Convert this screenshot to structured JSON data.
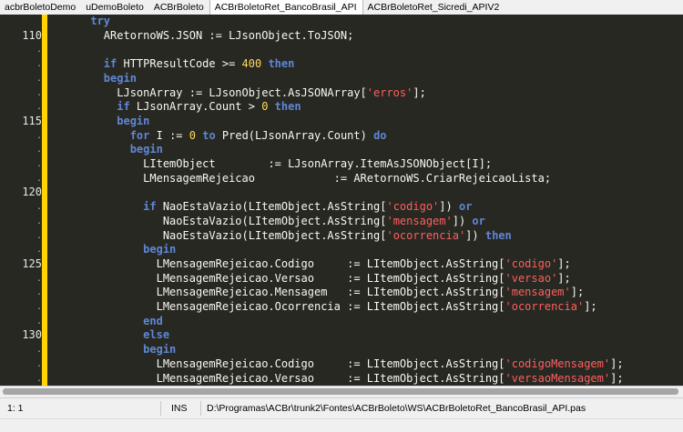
{
  "tabs": [
    {
      "label": "acbrBoletoDemo",
      "active": false
    },
    {
      "label": "uDemoBoleto",
      "active": false
    },
    {
      "label": "ACBrBoleto",
      "active": false
    },
    {
      "label": "ACBrBoletoRet_BancoBrasil_API",
      "active": true
    },
    {
      "label": "ACBrBoletoRet_Sicredi_APIV2",
      "active": false
    }
  ],
  "gutter": [
    "",
    "110",
    ".",
    ".",
    ".",
    ".",
    ".",
    "115",
    ".",
    ".",
    ".",
    ".",
    "120",
    ".",
    ".",
    ".",
    ".",
    "125",
    ".",
    ".",
    ".",
    ".",
    "130",
    ".",
    ".",
    ".",
    "."
  ],
  "code_lines": [
    [
      [
        "kw",
        "      try"
      ]
    ],
    [
      [
        "t",
        "        ARetornoWS.JSON := LJsonObject.ToJSON;"
      ]
    ],
    [
      [
        "t",
        ""
      ]
    ],
    [
      [
        "t",
        "        "
      ],
      [
        "kw",
        "if"
      ],
      [
        "t",
        " HTTPResultCode >= "
      ],
      [
        "num",
        "400"
      ],
      [
        "t",
        " "
      ],
      [
        "kw",
        "then"
      ]
    ],
    [
      [
        "t",
        "        "
      ],
      [
        "kw",
        "begin"
      ]
    ],
    [
      [
        "t",
        "          LJsonArray := LJsonObject.AsJSONArray["
      ],
      [
        "str",
        "'erros'"
      ],
      [
        "t",
        "];"
      ]
    ],
    [
      [
        "t",
        "          "
      ],
      [
        "kw",
        "if"
      ],
      [
        "t",
        " LJsonArray.Count > "
      ],
      [
        "num",
        "0"
      ],
      [
        "t",
        " "
      ],
      [
        "kw",
        "then"
      ]
    ],
    [
      [
        "t",
        "          "
      ],
      [
        "kw",
        "begin"
      ]
    ],
    [
      [
        "t",
        "            "
      ],
      [
        "kw",
        "for"
      ],
      [
        "t",
        " I := "
      ],
      [
        "num",
        "0"
      ],
      [
        "t",
        " "
      ],
      [
        "kw",
        "to"
      ],
      [
        "t",
        " Pred(LJsonArray.Count) "
      ],
      [
        "kw",
        "do"
      ]
    ],
    [
      [
        "t",
        "            "
      ],
      [
        "kw",
        "begin"
      ]
    ],
    [
      [
        "t",
        "              LItemObject        := LJsonArray.ItemAsJSONObject[I];"
      ]
    ],
    [
      [
        "t",
        "              LMensagemRejeicao            := ARetornoWS.CriarRejeicaoLista;"
      ]
    ],
    [
      [
        "t",
        ""
      ]
    ],
    [
      [
        "t",
        "              "
      ],
      [
        "kw",
        "if"
      ],
      [
        "t",
        " NaoEstaVazio(LItemObject.AsString["
      ],
      [
        "str",
        "'codigo'"
      ],
      [
        "t",
        "]) "
      ],
      [
        "kw",
        "or"
      ]
    ],
    [
      [
        "t",
        "                 NaoEstaVazio(LItemObject.AsString["
      ],
      [
        "str",
        "'mensagem'"
      ],
      [
        "t",
        "]) "
      ],
      [
        "kw",
        "or"
      ]
    ],
    [
      [
        "t",
        "                 NaoEstaVazio(LItemObject.AsString["
      ],
      [
        "str",
        "'ocorrencia'"
      ],
      [
        "t",
        "]) "
      ],
      [
        "kw",
        "then"
      ]
    ],
    [
      [
        "t",
        "              "
      ],
      [
        "kw",
        "begin"
      ]
    ],
    [
      [
        "t",
        "                LMensagemRejeicao.Codigo     := LItemObject.AsString["
      ],
      [
        "str",
        "'codigo'"
      ],
      [
        "t",
        "];"
      ]
    ],
    [
      [
        "t",
        "                LMensagemRejeicao.Versao     := LItemObject.AsString["
      ],
      [
        "str",
        "'versao'"
      ],
      [
        "t",
        "];"
      ]
    ],
    [
      [
        "t",
        "                LMensagemRejeicao.Mensagem   := LItemObject.AsString["
      ],
      [
        "str",
        "'mensagem'"
      ],
      [
        "t",
        "];"
      ]
    ],
    [
      [
        "t",
        "                LMensagemRejeicao.Ocorrencia := LItemObject.AsString["
      ],
      [
        "str",
        "'ocorrencia'"
      ],
      [
        "t",
        "];"
      ]
    ],
    [
      [
        "t",
        "              "
      ],
      [
        "kw",
        "end"
      ]
    ],
    [
      [
        "t",
        "              "
      ],
      [
        "kw",
        "else"
      ]
    ],
    [
      [
        "t",
        "              "
      ],
      [
        "kw",
        "begin"
      ]
    ],
    [
      [
        "t",
        "                LMensagemRejeicao.Codigo     := LItemObject.AsString["
      ],
      [
        "str",
        "'codigoMensagem'"
      ],
      [
        "t",
        "];"
      ]
    ],
    [
      [
        "t",
        "                LMensagemRejeicao.Versao     := LItemObject.AsString["
      ],
      [
        "str",
        "'versaoMensagem'"
      ],
      [
        "t",
        "];"
      ]
    ]
  ],
  "status": {
    "position": "1: 1",
    "mode": "INS",
    "file_path": "D:\\Programas\\ACBr\\trunk2\\Fontes\\ACBrBoleto\\WS\\ACBrBoletoRet_BancoBrasil_API.pas"
  },
  "colors": {
    "editor_bg": "#272822",
    "gutter_marker": "#ffd400",
    "keyword": "#5f87d7",
    "string": "#ff5f5f",
    "number": "#ffd75f"
  }
}
